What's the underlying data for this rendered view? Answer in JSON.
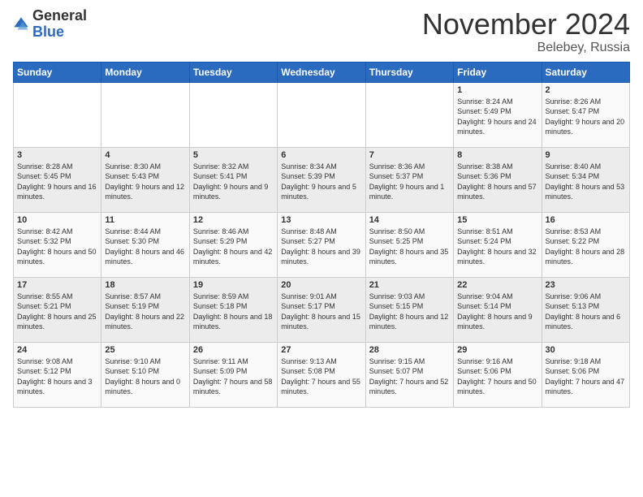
{
  "logo": {
    "general": "General",
    "blue": "Blue"
  },
  "header": {
    "month": "November 2024",
    "location": "Belebey, Russia"
  },
  "weekdays": [
    "Sunday",
    "Monday",
    "Tuesday",
    "Wednesday",
    "Thursday",
    "Friday",
    "Saturday"
  ],
  "weeks": [
    [
      {
        "day": "",
        "sunrise": "",
        "sunset": "",
        "daylight": ""
      },
      {
        "day": "",
        "sunrise": "",
        "sunset": "",
        "daylight": ""
      },
      {
        "day": "",
        "sunrise": "",
        "sunset": "",
        "daylight": ""
      },
      {
        "day": "",
        "sunrise": "",
        "sunset": "",
        "daylight": ""
      },
      {
        "day": "",
        "sunrise": "",
        "sunset": "",
        "daylight": ""
      },
      {
        "day": "1",
        "sunrise": "Sunrise: 8:24 AM",
        "sunset": "Sunset: 5:49 PM",
        "daylight": "Daylight: 9 hours and 24 minutes."
      },
      {
        "day": "2",
        "sunrise": "Sunrise: 8:26 AM",
        "sunset": "Sunset: 5:47 PM",
        "daylight": "Daylight: 9 hours and 20 minutes."
      }
    ],
    [
      {
        "day": "3",
        "sunrise": "Sunrise: 8:28 AM",
        "sunset": "Sunset: 5:45 PM",
        "daylight": "Daylight: 9 hours and 16 minutes."
      },
      {
        "day": "4",
        "sunrise": "Sunrise: 8:30 AM",
        "sunset": "Sunset: 5:43 PM",
        "daylight": "Daylight: 9 hours and 12 minutes."
      },
      {
        "day": "5",
        "sunrise": "Sunrise: 8:32 AM",
        "sunset": "Sunset: 5:41 PM",
        "daylight": "Daylight: 9 hours and 9 minutes."
      },
      {
        "day": "6",
        "sunrise": "Sunrise: 8:34 AM",
        "sunset": "Sunset: 5:39 PM",
        "daylight": "Daylight: 9 hours and 5 minutes."
      },
      {
        "day": "7",
        "sunrise": "Sunrise: 8:36 AM",
        "sunset": "Sunset: 5:37 PM",
        "daylight": "Daylight: 9 hours and 1 minute."
      },
      {
        "day": "8",
        "sunrise": "Sunrise: 8:38 AM",
        "sunset": "Sunset: 5:36 PM",
        "daylight": "Daylight: 8 hours and 57 minutes."
      },
      {
        "day": "9",
        "sunrise": "Sunrise: 8:40 AM",
        "sunset": "Sunset: 5:34 PM",
        "daylight": "Daylight: 8 hours and 53 minutes."
      }
    ],
    [
      {
        "day": "10",
        "sunrise": "Sunrise: 8:42 AM",
        "sunset": "Sunset: 5:32 PM",
        "daylight": "Daylight: 8 hours and 50 minutes."
      },
      {
        "day": "11",
        "sunrise": "Sunrise: 8:44 AM",
        "sunset": "Sunset: 5:30 PM",
        "daylight": "Daylight: 8 hours and 46 minutes."
      },
      {
        "day": "12",
        "sunrise": "Sunrise: 8:46 AM",
        "sunset": "Sunset: 5:29 PM",
        "daylight": "Daylight: 8 hours and 42 minutes."
      },
      {
        "day": "13",
        "sunrise": "Sunrise: 8:48 AM",
        "sunset": "Sunset: 5:27 PM",
        "daylight": "Daylight: 8 hours and 39 minutes."
      },
      {
        "day": "14",
        "sunrise": "Sunrise: 8:50 AM",
        "sunset": "Sunset: 5:25 PM",
        "daylight": "Daylight: 8 hours and 35 minutes."
      },
      {
        "day": "15",
        "sunrise": "Sunrise: 8:51 AM",
        "sunset": "Sunset: 5:24 PM",
        "daylight": "Daylight: 8 hours and 32 minutes."
      },
      {
        "day": "16",
        "sunrise": "Sunrise: 8:53 AM",
        "sunset": "Sunset: 5:22 PM",
        "daylight": "Daylight: 8 hours and 28 minutes."
      }
    ],
    [
      {
        "day": "17",
        "sunrise": "Sunrise: 8:55 AM",
        "sunset": "Sunset: 5:21 PM",
        "daylight": "Daylight: 8 hours and 25 minutes."
      },
      {
        "day": "18",
        "sunrise": "Sunrise: 8:57 AM",
        "sunset": "Sunset: 5:19 PM",
        "daylight": "Daylight: 8 hours and 22 minutes."
      },
      {
        "day": "19",
        "sunrise": "Sunrise: 8:59 AM",
        "sunset": "Sunset: 5:18 PM",
        "daylight": "Daylight: 8 hours and 18 minutes."
      },
      {
        "day": "20",
        "sunrise": "Sunrise: 9:01 AM",
        "sunset": "Sunset: 5:17 PM",
        "daylight": "Daylight: 8 hours and 15 minutes."
      },
      {
        "day": "21",
        "sunrise": "Sunrise: 9:03 AM",
        "sunset": "Sunset: 5:15 PM",
        "daylight": "Daylight: 8 hours and 12 minutes."
      },
      {
        "day": "22",
        "sunrise": "Sunrise: 9:04 AM",
        "sunset": "Sunset: 5:14 PM",
        "daylight": "Daylight: 8 hours and 9 minutes."
      },
      {
        "day": "23",
        "sunrise": "Sunrise: 9:06 AM",
        "sunset": "Sunset: 5:13 PM",
        "daylight": "Daylight: 8 hours and 6 minutes."
      }
    ],
    [
      {
        "day": "24",
        "sunrise": "Sunrise: 9:08 AM",
        "sunset": "Sunset: 5:12 PM",
        "daylight": "Daylight: 8 hours and 3 minutes."
      },
      {
        "day": "25",
        "sunrise": "Sunrise: 9:10 AM",
        "sunset": "Sunset: 5:10 PM",
        "daylight": "Daylight: 8 hours and 0 minutes."
      },
      {
        "day": "26",
        "sunrise": "Sunrise: 9:11 AM",
        "sunset": "Sunset: 5:09 PM",
        "daylight": "Daylight: 7 hours and 58 minutes."
      },
      {
        "day": "27",
        "sunrise": "Sunrise: 9:13 AM",
        "sunset": "Sunset: 5:08 PM",
        "daylight": "Daylight: 7 hours and 55 minutes."
      },
      {
        "day": "28",
        "sunrise": "Sunrise: 9:15 AM",
        "sunset": "Sunset: 5:07 PM",
        "daylight": "Daylight: 7 hours and 52 minutes."
      },
      {
        "day": "29",
        "sunrise": "Sunrise: 9:16 AM",
        "sunset": "Sunset: 5:06 PM",
        "daylight": "Daylight: 7 hours and 50 minutes."
      },
      {
        "day": "30",
        "sunrise": "Sunrise: 9:18 AM",
        "sunset": "Sunset: 5:06 PM",
        "daylight": "Daylight: 7 hours and 47 minutes."
      }
    ]
  ]
}
